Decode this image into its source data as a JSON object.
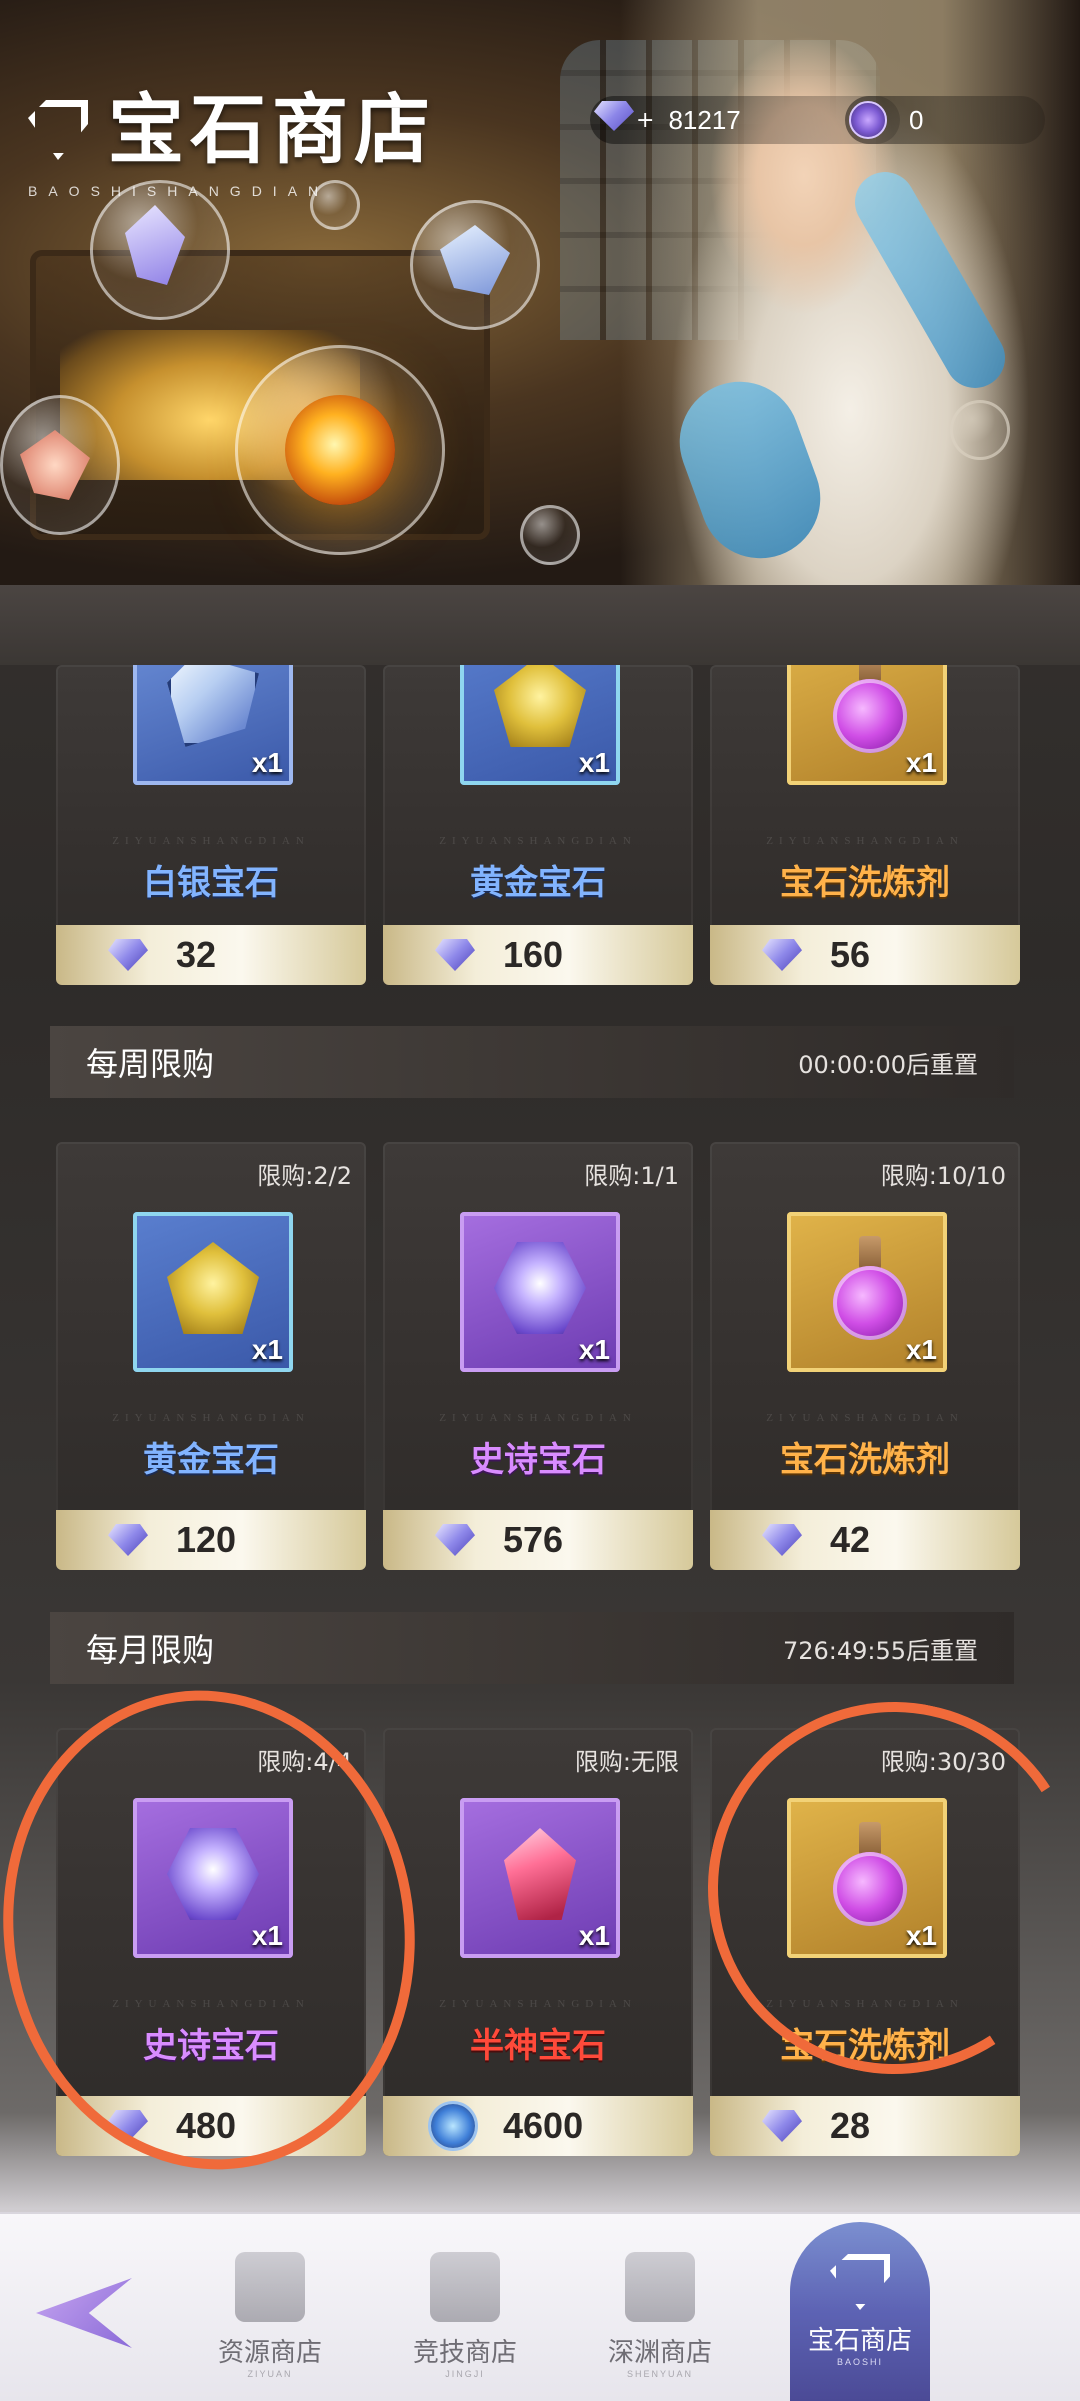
{
  "header": {
    "title": "宝石商店",
    "subtitle": "BAOSHISHANGDIAN",
    "gem_balance": "81217",
    "gem_plus": "+",
    "token_balance": "0"
  },
  "top_row": [
    {
      "name": "白银宝石",
      "qty": "x1",
      "price": "32",
      "watermark": "ZIYUANSHANGDIAN"
    },
    {
      "name": "黄金宝石",
      "qty": "x1",
      "price": "160",
      "watermark": "ZIYUANSHANGDIAN"
    },
    {
      "name": "宝石洗炼剂",
      "qty": "x1",
      "price": "56",
      "watermark": "ZIYUANSHANGDIAN"
    }
  ],
  "weekly": {
    "title": "每周限购",
    "timer": "00:00:00后重置",
    "items": [
      {
        "limit": "限购:2/2",
        "name": "黄金宝石",
        "qty": "x1",
        "price": "120",
        "watermark": "ZIYUANSHANGDIAN"
      },
      {
        "limit": "限购:1/1",
        "name": "史诗宝石",
        "qty": "x1",
        "price": "576",
        "watermark": "ZIYUANSHANGDIAN"
      },
      {
        "limit": "限购:10/10",
        "name": "宝石洗炼剂",
        "qty": "x1",
        "price": "42",
        "watermark": "ZIYUANSHANGDIAN"
      }
    ]
  },
  "monthly": {
    "title": "每月限购",
    "timer": "726:49:55后重置",
    "items": [
      {
        "limit": "限购:4/4",
        "name": "史诗宝石",
        "qty": "x1",
        "price": "480",
        "watermark": "ZIYUANSHANGDIAN"
      },
      {
        "limit": "限购:无限",
        "name": "半神宝石",
        "qty": "x1",
        "price": "4600",
        "watermark": "ZIYUANSHANGDIAN"
      },
      {
        "limit": "限购:30/30",
        "name": "宝石洗炼剂",
        "qty": "x1",
        "price": "28",
        "watermark": "ZIYUANSHANGDIAN"
      }
    ]
  },
  "nav": {
    "items": [
      {
        "label": "资源商店",
        "sub": "ZIYUAN"
      },
      {
        "label": "竞技商店",
        "sub": "JINGJI"
      },
      {
        "label": "深渊商店",
        "sub": "SHENYUAN"
      },
      {
        "label": "宝石商店",
        "sub": "BAOSHI"
      }
    ]
  },
  "colors": {
    "annotation": "#f06a3a",
    "nav_active": "#5d63b4"
  }
}
